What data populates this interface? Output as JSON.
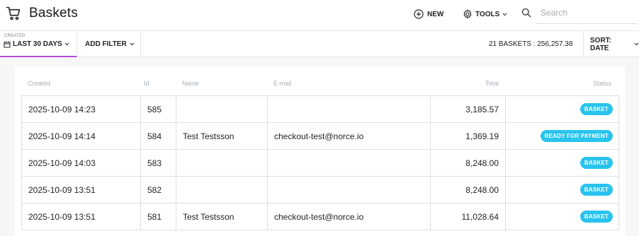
{
  "app": {
    "title": "Baskets",
    "new_label": "NEW",
    "tools_label": "TOOLS",
    "search_placeholder": "Search"
  },
  "filters": {
    "created_label": "CREATED",
    "created_value": "LAST 30 DAYS",
    "add_filter_label": "ADD FILTER",
    "summary": "21 BASKETS : 256,257.38",
    "sort_label": "SORT: DATE"
  },
  "table": {
    "columns": [
      "Created",
      "Id",
      "Name",
      "E-mail",
      "Total",
      "Status"
    ],
    "rows": [
      {
        "created": "2025-10-09 14:23",
        "id": "585",
        "name": "",
        "email": "",
        "total": "3,185.57",
        "status": "BASKET"
      },
      {
        "created": "2025-10-09 14:14",
        "id": "584",
        "name": "Test Testsson",
        "email": "checkout-test@norce.io",
        "total": "1,369.19",
        "status": "READY FOR PAYMENT"
      },
      {
        "created": "2025-10-09 14:03",
        "id": "583",
        "name": "",
        "email": "",
        "total": "8,248.00",
        "status": "BASKET"
      },
      {
        "created": "2025-10-09 13:51",
        "id": "582",
        "name": "",
        "email": "",
        "total": "8,248.00",
        "status": "BASKET"
      },
      {
        "created": "2025-10-09 13:51",
        "id": "581",
        "name": "Test Testsson",
        "email": "checkout-test@norce.io",
        "total": "11,028.64",
        "status": "BASKET"
      }
    ]
  },
  "colors": {
    "accent": "#b84be0",
    "status_badge": "#29c3ee"
  },
  "icons": {
    "cart": "cart-icon",
    "new": "plus-circle-icon",
    "tools": "gear-icon",
    "search": "search-icon",
    "calendar": "calendar-icon",
    "chevron": "chevron-down-icon"
  }
}
